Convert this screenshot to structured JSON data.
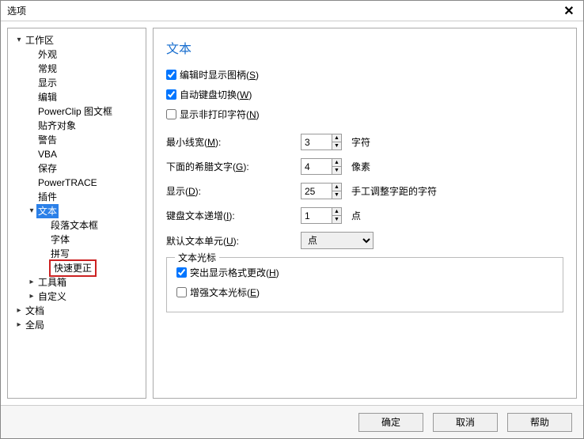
{
  "dialog": {
    "title": "选项"
  },
  "tree": {
    "workspace": "工作区",
    "items1": [
      "外观",
      "常规",
      "显示",
      "编辑",
      "PowerClip 图文框",
      "贴齐对象",
      "警告",
      "VBA",
      "保存",
      "PowerTRACE",
      "插件"
    ],
    "text": "文本",
    "text_items": [
      "段落文本框",
      "字体",
      "拼写",
      "快速更正"
    ],
    "toolbox": "工具箱",
    "customize": "自定义",
    "document": "文档",
    "global": "全局"
  },
  "content": {
    "heading": "文本",
    "chk_edit_handles": "编辑时显示图柄(",
    "chk_edit_handles_key": "S",
    "chk_auto_kb": "自动键盘切换(",
    "chk_auto_kb_key": "W",
    "chk_nonprint": "显示非打印字符(",
    "chk_nonprint_key": "N",
    "row_minwidth": "最小线宽(",
    "row_minwidth_key": "M",
    "row_minwidth_val": "3",
    "row_minwidth_unit": "字符",
    "row_greek": "下面的希腊文字(",
    "row_greek_key": "G",
    "row_greek_val": "4",
    "row_greek_unit": "像素",
    "row_display": "显示(",
    "row_display_key": "D",
    "row_display_val": "25",
    "row_display_unit": "手工调整字距的字符",
    "row_kbinc": "键盘文本递增(",
    "row_kbinc_key": "I",
    "row_kbinc_val": "1",
    "row_kbinc_unit": "点",
    "row_defunit": "默认文本单元(",
    "row_defunit_key": "U",
    "row_defunit_val": "点",
    "group_legend": "文本光标",
    "chk_fmt": "突出显示格式更改(",
    "chk_fmt_key": "H",
    "chk_enh": "增强文本光标(",
    "chk_enh_key": "E"
  },
  "footer": {
    "ok": "确定",
    "cancel": "取消",
    "help": "帮助"
  }
}
